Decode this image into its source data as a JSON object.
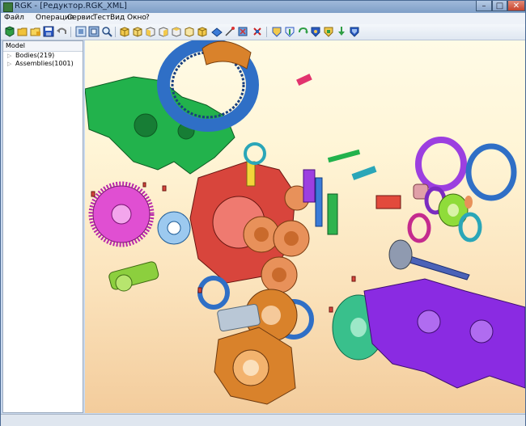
{
  "window": {
    "title": "RGK - [Редуктор.RGK_XML]",
    "controls": {
      "minimize": "–",
      "maximize": "□",
      "close": "✕"
    }
  },
  "menu": [
    {
      "id": "file",
      "label": "Файл"
    },
    {
      "id": "operation",
      "label": "Операция"
    },
    {
      "id": "service",
      "label": "Сервис"
    },
    {
      "id": "test",
      "label": "Тест"
    },
    {
      "id": "view",
      "label": "Вид"
    },
    {
      "id": "window",
      "label": "Окно"
    },
    {
      "id": "help",
      "label": "?"
    }
  ],
  "toolbar": {
    "icons": [
      "new-body-icon",
      "open-folder-icon",
      "open-folder-alt-icon",
      "save-icon",
      "undo-icon",
      "view-shaded-icon",
      "view-fit-icon",
      "zoom-icon",
      "view-front-icon",
      "view-back-icon",
      "view-left-icon",
      "view-right-icon",
      "view-top-icon",
      "view-bottom-icon",
      "view-iso-icon",
      "section-icon",
      "measure-icon",
      "transform-icon",
      "boolean-union-icon",
      "boolean-cut-icon",
      "rotate-icon",
      "fillet-icon",
      "chamfer-icon",
      "extrude-icon",
      "shell-icon"
    ]
  },
  "model_panel": {
    "header": "Model",
    "items": [
      {
        "label": "Bodies(219)"
      },
      {
        "label": "Assemblies(1001)"
      }
    ]
  },
  "colors": {
    "viewport_top": "#fffbe6",
    "viewport_bottom": "#f3cc9c",
    "part_green": "#22b24c",
    "part_blue": "#2f6fc6",
    "part_orange": "#d9822b",
    "part_magenta": "#d63cc8",
    "part_purple": "#8a2be2",
    "part_red": "#d8453c",
    "part_teal": "#2aa6b8"
  }
}
